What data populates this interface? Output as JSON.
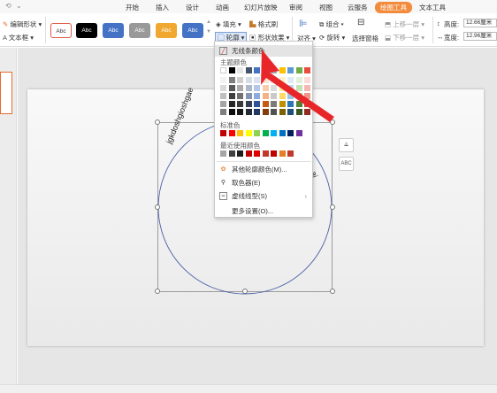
{
  "quick_access": {
    "left_icon": "undo-icon",
    "dropdown_icon": "chevron-down-icon"
  },
  "tabs": [
    "开始",
    "插入",
    "设计",
    "动画",
    "幻灯片放映",
    "审阅",
    "视图",
    "云服务",
    "绘图工具",
    "文本工具"
  ],
  "active_tab": "绘图工具",
  "ribbon": {
    "edit_shape": "编辑形状",
    "text_box": "文本框",
    "style_label": "Abc",
    "fill": "填充",
    "format_painter": "格式刷",
    "outline": "轮廓",
    "shape_effects": "形状效果",
    "align": "对齐",
    "group": "组合",
    "rotate": "旋转",
    "selection_pane": "选择窗格",
    "bring_forward": "上移一层",
    "send_backward": "下移一层",
    "height_label": "高度:",
    "height_value": "12.66厘米",
    "width_label": "宽度:",
    "width_value": "12.96厘米",
    "style_colors": [
      "#ffffff",
      "#000000",
      "#4472c4",
      "#999999",
      "#f0a830",
      "#4472c4"
    ]
  },
  "slide": {
    "arc_text_left": "jgkdoshgioshgae",
    "arc_text_right": "ai",
    "side_buttons": [
      "shape-icon",
      "ABC"
    ],
    "circle_color": "#4b5fa8"
  },
  "dropdown": {
    "no_outline": "无线条颜色",
    "theme_colors_label": "主题颜色",
    "standard_colors_label": "标准色",
    "recent_colors_label": "最近使用颜色",
    "more_colors": "其他轮廓颜色(M)...",
    "eyedropper": "取色器(E)",
    "dash_type": "虚线线型(S)",
    "more_settings": "更多设置(O)...",
    "theme_top_row": [
      "#ffffff",
      "#000000",
      "#e7e6e6",
      "#44546a",
      "#4472c4",
      "#ed7d31",
      "#a5a5a5",
      "#ffc000",
      "#5b9bd5",
      "#70ad47",
      "#e74c3c"
    ],
    "theme_shades": [
      [
        "#f2f2f2",
        "#7f7f7f",
        "#d0cece",
        "#d6dce4",
        "#d9e2f3",
        "#fbe5d6",
        "#ededed",
        "#fff2cc",
        "#deebf6",
        "#e2efd9",
        "#fadbd8"
      ],
      [
        "#d9d9d9",
        "#595959",
        "#aeabab",
        "#adb9ca",
        "#b4c7e7",
        "#f8cbad",
        "#dbdbdb",
        "#ffe699",
        "#bdd7ee",
        "#c5e0b3",
        "#f5b7b1"
      ],
      [
        "#bfbfbf",
        "#3f3f3f",
        "#757070",
        "#8496b0",
        "#8faadc",
        "#f4b183",
        "#c9c9c9",
        "#ffd966",
        "#9dc3e6",
        "#a9d18e",
        "#f1948a"
      ],
      [
        "#a5a5a5",
        "#262626",
        "#3a3838",
        "#333f4f",
        "#2f5597",
        "#c55a11",
        "#7b7b7b",
        "#bf9000",
        "#2e75b6",
        "#538135",
        "#cb4335"
      ],
      [
        "#7f7f7f",
        "#0d0d0d",
        "#171616",
        "#222a35",
        "#1f3864",
        "#833c0b",
        "#525252",
        "#7f6000",
        "#1f4e79",
        "#385723",
        "#922b21"
      ]
    ],
    "standard_colors": [
      "#c00000",
      "#ff0000",
      "#ffc000",
      "#ffff00",
      "#92d050",
      "#00b050",
      "#00b0f0",
      "#0070c0",
      "#002060",
      "#7030a0"
    ],
    "recent_colors": [
      "#a6a6a6",
      "#404040",
      "#1f1f1f",
      "#c00000",
      "#e00000",
      "#c0392b",
      "#c00000",
      "#e67e22",
      "#c0392b"
    ]
  },
  "arrow_color": "#e8262a"
}
